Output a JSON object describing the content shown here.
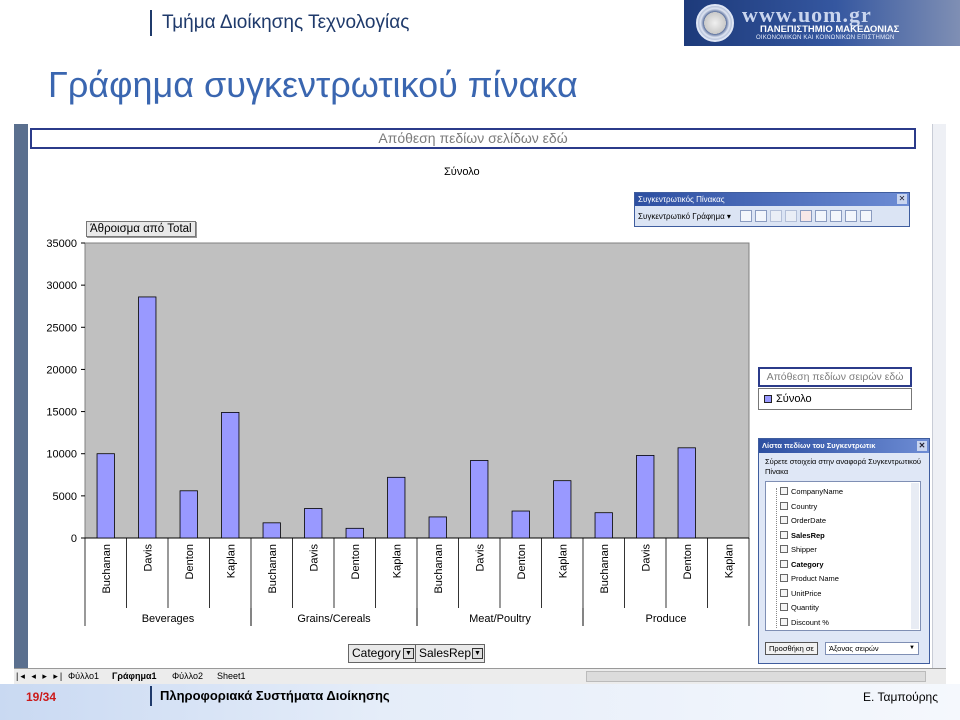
{
  "header": {
    "department": "Τμήμα Διοίκησης Τεχνολογίας",
    "university_url": "www.uom.gr",
    "university_name": "ΠΑΝΕΠΙΣΤΗΜΙΟ ΜΑΚΕΔΟΝΙΑΣ",
    "university_sub": "ΟΙΚΟΝΟΜΙΚΩΝ ΚΑΙ ΚΟΙΝΩΝΙΚΩΝ ΕΠΙΣΤΗΜΩΝ"
  },
  "slide_title": "Γράφημα συγκεντρωτικού πίνακα",
  "excel": {
    "page_drop_zone": "Απόθεση πεδίων σελίδων εδώ",
    "data_field_button": "Άθροισμα από Total",
    "series_drop_zone": "Απόθεση πεδίων σειρών εδώ",
    "category_fields": [
      "Category",
      "SalesRep"
    ],
    "pivot_toolbar": {
      "title": "Συγκεντρωτικός Πίνακας",
      "menu": "Συγκεντρωτικό Γράφημα ▾"
    },
    "field_list": {
      "title": "Λίστα πεδίων του Συγκεντρωτικ",
      "instruction": "Σύρετε στοιχεία στην αναφορά Συγκεντρωτικού Πίνακα",
      "fields": [
        "CompanyName",
        "Country",
        "OrderDate",
        "SalesRep",
        "Shipper",
        "Category",
        "Product Name",
        "UnitPrice",
        "Quantity",
        "Discount %"
      ],
      "bold_fields": [
        "SalesRep",
        "Category"
      ],
      "add_button": "Προσθήκη σε",
      "area_select": "Άξονας σειρών"
    },
    "sheet_nav": "|◂ ◂ ▸ ▸|",
    "sheet_tabs": [
      "Φύλλο1",
      "Γράφημα1",
      "Φύλλο2",
      "Sheet1"
    ],
    "active_sheet": "Γράφημα1"
  },
  "chart_data": {
    "type": "bar",
    "title": "Σύνολο",
    "ylim": [
      0,
      35000
    ],
    "yticks": [
      0,
      5000,
      10000,
      15000,
      20000,
      25000,
      30000,
      35000
    ],
    "groups": [
      {
        "name": "Beverages",
        "categories": [
          "Buchanan",
          "Davis",
          "Denton",
          "Kaplan"
        ]
      },
      {
        "name": "Grains/Cereals",
        "categories": [
          "Buchanan",
          "Davis",
          "Denton",
          "Kaplan"
        ]
      },
      {
        "name": "Meat/Poultry",
        "categories": [
          "Buchanan",
          "Davis",
          "Denton",
          "Kaplan"
        ]
      },
      {
        "name": "Produce",
        "categories": [
          "Buchanan",
          "Davis",
          "Denton",
          "Kaplan"
        ]
      }
    ],
    "series": [
      {
        "name": "Σύνολο",
        "values": [
          10000,
          28600,
          5600,
          14900,
          1800,
          3500,
          1150,
          7200,
          2500,
          9200,
          3200,
          6800,
          3000,
          9800,
          10700
        ]
      }
    ],
    "legend": "right",
    "colors": {
      "bar": "#9999ff",
      "plot_bg": "#c0c0c0"
    }
  },
  "footer": {
    "page": "19/34",
    "course": "Πληροφοριακά Συστήματα Διοίκησης",
    "author": "Ε. Ταμπούρης"
  }
}
